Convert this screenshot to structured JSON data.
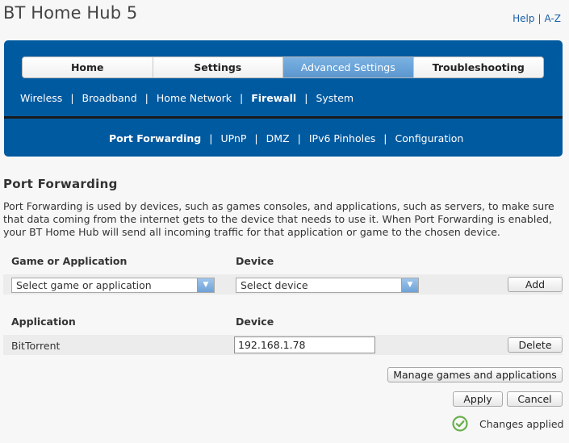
{
  "header": {
    "app_title": "BT Home Hub 5",
    "help_link": "Help",
    "separator": "|",
    "az_link": "A-Z"
  },
  "nav": {
    "tabs": [
      {
        "label": "Home",
        "active": false
      },
      {
        "label": "Settings",
        "active": false
      },
      {
        "label": "Advanced Settings",
        "active": true
      },
      {
        "label": "Troubleshooting",
        "active": false
      }
    ],
    "sub_items": [
      {
        "label": "Wireless",
        "active": false
      },
      {
        "label": "Broadband",
        "active": false
      },
      {
        "label": "Home Network",
        "active": false
      },
      {
        "label": "Firewall",
        "active": true
      },
      {
        "label": "System",
        "active": false
      }
    ],
    "sub_sub_items": [
      {
        "label": "Port Forwarding",
        "active": true
      },
      {
        "label": "UPnP",
        "active": false
      },
      {
        "label": "DMZ",
        "active": false
      },
      {
        "label": "IPv6 Pinholes",
        "active": false
      },
      {
        "label": "Configuration",
        "active": false
      }
    ],
    "separator": "|"
  },
  "page": {
    "title": "Port Forwarding",
    "description": "Port Forwarding is used by devices, such as games consoles, and applications, such as servers, to make sure that data coming from the internet gets to the device that needs to use it. When Port Forwarding is enabled, your BT Home Hub will send all incoming traffic for that application or game to the chosen device."
  },
  "add_form": {
    "col_game_header": "Game or Application",
    "col_device_header": "Device",
    "game_select_value": "Select game or application",
    "device_select_value": "Select device",
    "add_button": "Add"
  },
  "rules_table": {
    "col_application_header": "Application",
    "col_device_header": "Device",
    "rows": [
      {
        "application": "BitTorrent",
        "device": "192.168.1.78",
        "delete_label": "Delete"
      }
    ]
  },
  "actions": {
    "manage_button": "Manage games and applications",
    "apply_button": "Apply",
    "cancel_button": "Cancel"
  },
  "status": {
    "text": "Changes applied",
    "icon": "check-circle-icon",
    "icon_color": "#6ab04c"
  },
  "colors": {
    "nav_blue": "#005aa0",
    "active_tab": "#6aa5db",
    "link_blue": "#1a5ea8"
  }
}
